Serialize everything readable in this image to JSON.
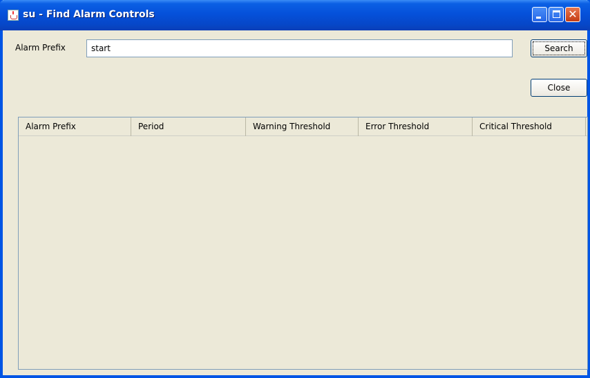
{
  "window": {
    "title": "su - Find Alarm Controls"
  },
  "search": {
    "label": "Alarm Prefix",
    "value": "start"
  },
  "buttons": {
    "search": "Search",
    "close": "Close"
  },
  "table": {
    "columns": [
      "Alarm Prefix",
      "Period",
      "Warning Threshold",
      "Error Threshold",
      "Critical Threshold"
    ],
    "rows": []
  }
}
